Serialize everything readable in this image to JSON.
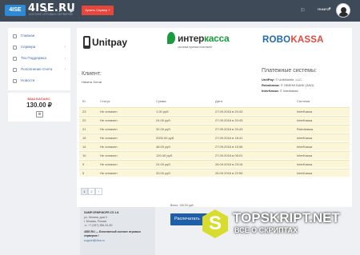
{
  "header": {
    "logo_mark": "4ISE",
    "brand": "4ISE.RU",
    "tagline": "ХОСТИНГ ИГРОВЫХ СЕРВЕРОВ",
    "buy_button": "Купить Сервер +",
    "user_name": "Никита",
    "user_arrow": "▾"
  },
  "sidebar": {
    "items": [
      {
        "label": "Главная",
        "icon": "home-icon",
        "arrow": ""
      },
      {
        "label": "Сервера",
        "icon": "server-icon",
        "arrow": "›"
      },
      {
        "label": "Тех.Поддержка",
        "icon": "support-icon",
        "arrow": "›"
      },
      {
        "label": "Пополнение Счета",
        "icon": "wallet-icon",
        "arrow": "›"
      },
      {
        "label": "Новости",
        "icon": "news-icon",
        "arrow": ""
      }
    ],
    "balance_label": "ВАШ БАЛАНС:",
    "balance_value": "130.00 ₽",
    "balance_button": "⊕"
  },
  "payment_logos": {
    "unitpay": "Unitpay",
    "interkassa_main": "интер",
    "interkassa_accent": "касса",
    "interkassa_sub": "система приема платежей",
    "robo_main": "ROBO",
    "robo_accent": "KASSA"
  },
  "client": {
    "title": "Клиент:",
    "name": "Никита Зотов"
  },
  "systems": {
    "title": "Платежные системы:",
    "lines": [
      {
        "name": "UnitPay:",
        "value": "© UnitMobile, LLC."
      },
      {
        "name": "Robokassa:",
        "value": "© ОБЕНИ БАНК (ЗАО)"
      },
      {
        "name": "InterKassa:",
        "value": "© Interkassa"
      }
    ]
  },
  "table": {
    "headers": [
      "ID",
      "Статус",
      "Сумма",
      "Дата",
      "Система"
    ],
    "rows": [
      [
        "23",
        "Не оплачен",
        "1.00 руб.",
        "27.09.2016 в 20:43",
        "InterKassa"
      ],
      [
        "22",
        "Не оплачен",
        "24.00 руб.",
        "27.09.2016 в 20:43",
        "InterKassa"
      ],
      [
        "21",
        "Не оплачен",
        "32.00 руб.",
        "27.09.2016 в 20:43",
        "Robokassa"
      ],
      [
        "15",
        "Не оплачен",
        "2000.00 руб.",
        "27.09.2016 в 18:41",
        "InterKassa"
      ],
      [
        "14",
        "Не оплачен",
        "48.00 руб.",
        "27.09.2016 в 15:06",
        "InterKassa"
      ],
      [
        "10",
        "Не оплачен",
        "120.00 руб.",
        "27.09.2016 в 05:01",
        "InterKassa"
      ],
      [
        "9",
        "Не оплачен",
        "24.00 руб.",
        "26.09.2016 в 23:16",
        "InterKassa"
      ],
      [
        "5",
        "Не оплачен",
        "33.00 руб.",
        "26.09.2016 в 22:59",
        "InterKassa"
      ]
    ]
  },
  "pagination": [
    "1",
    "2",
    "›"
  ],
  "footer": {
    "company": "SAMP.CRMP.MCPE.CS 1.6.",
    "address1": "ул. Ленина, дом 0",
    "address2": "г. Москва, Россия",
    "phone": "☏ +7 (937) 356-31-50",
    "about_bold": "4ISE.RU — Бесплатный хостинг игровых",
    "about_bold2": "серверов !",
    "email": "support@4ise.ru"
  },
  "bottom": {
    "total": "Всего: 130.00 руб.",
    "pay_button": "Распечатать"
  },
  "watermark": {
    "letter": "S",
    "title": "TOPSKRIPT.NET",
    "subtitle": "ВСЕ О СКРИПТАХ"
  },
  "colors": {
    "topbar": "#3f4a59",
    "accent_red": "#e6473c",
    "link_blue": "#3d6ea8",
    "row_highlight": "#fcf6d8"
  }
}
